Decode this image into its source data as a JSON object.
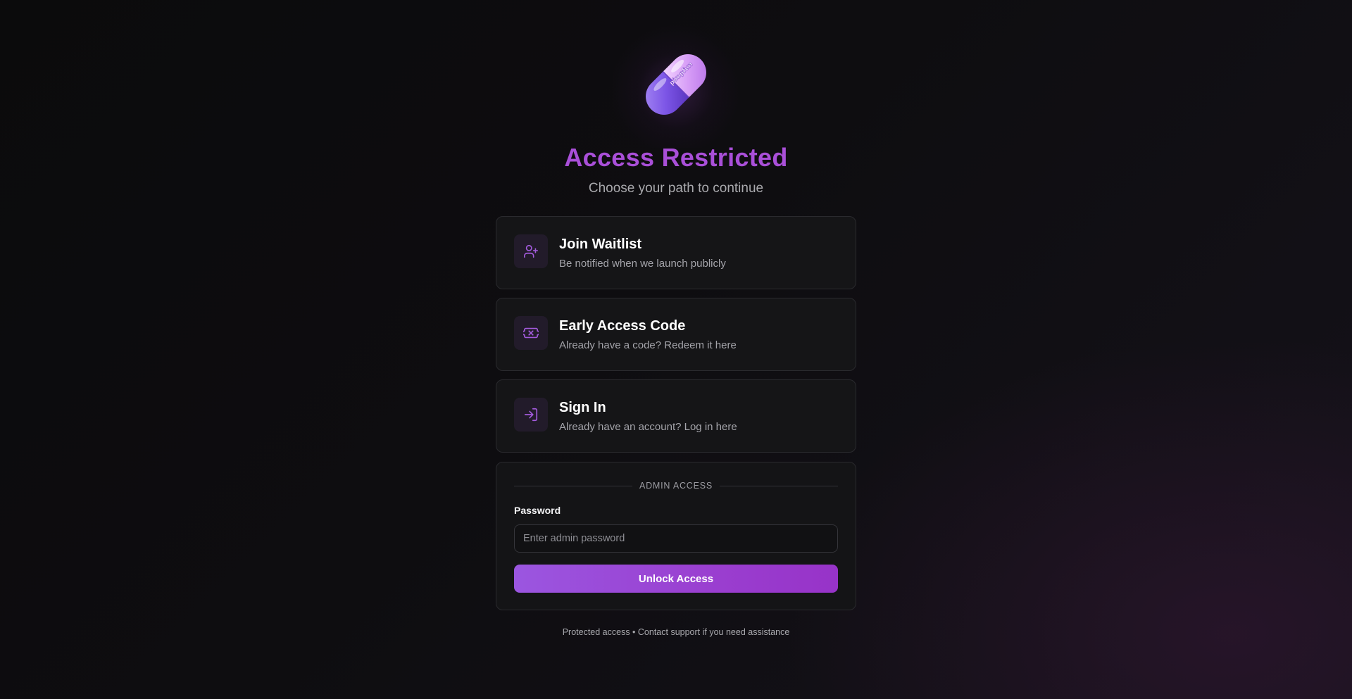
{
  "logo": {
    "text": "pimpfun",
    "icon": "pill-capsule-logo"
  },
  "header": {
    "title": "Access Restricted",
    "subtitle": "Choose your path to continue"
  },
  "options": [
    {
      "icon": "user-plus-icon",
      "title": "Join Waitlist",
      "description": "Be notified when we launch publicly"
    },
    {
      "icon": "ticket-icon",
      "title": "Early Access Code",
      "description": "Already have a code? Redeem it here"
    },
    {
      "icon": "log-in-icon",
      "title": "Sign In",
      "description": "Already have an account? Log in here"
    }
  ],
  "admin": {
    "section_label": "ADMIN ACCESS",
    "password_label": "Password",
    "password_value": "",
    "password_placeholder": "Enter admin password",
    "unlock_label": "Unlock Access"
  },
  "footer": {
    "text": "Protected access • Contact support if you need assistance"
  },
  "colors": {
    "accent": "#a94fd8",
    "button_gradient_start": "#9b56e0",
    "button_gradient_end": "#9733c8",
    "icon_stroke": "#a35bdc",
    "card_bg": "#151517"
  }
}
